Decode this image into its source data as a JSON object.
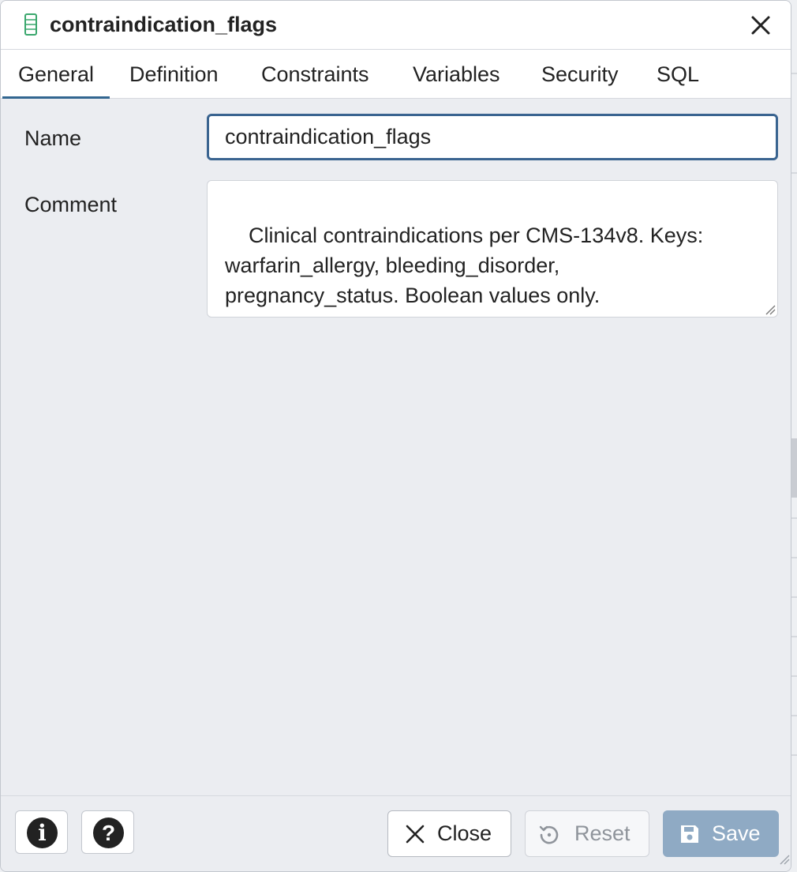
{
  "dialog": {
    "title": "contraindication_flags",
    "title_icon": "table-column-icon",
    "close_icon": "close-icon"
  },
  "tabs": [
    {
      "label": "General",
      "active": true
    },
    {
      "label": "Definition",
      "active": false
    },
    {
      "label": "Constraints",
      "active": false
    },
    {
      "label": "Variables",
      "active": false
    },
    {
      "label": "Security",
      "active": false
    },
    {
      "label": "SQL",
      "active": false
    }
  ],
  "form": {
    "name_label": "Name",
    "name_value": "contraindication_flags",
    "comment_label": "Comment",
    "comment_value": "Clinical contraindications per CMS-134v8. Keys:\nwarfarin_allergy, bleeding_disorder,\npregnancy_status. Boolean values only."
  },
  "footer": {
    "info_icon": "info-icon",
    "help_icon": "help-icon",
    "close_label": "Close",
    "reset_label": "Reset",
    "save_label": "Save"
  },
  "colors": {
    "accent": "#326690",
    "save_disabled": "#8faac4",
    "icon_green": "#3aa76d"
  }
}
